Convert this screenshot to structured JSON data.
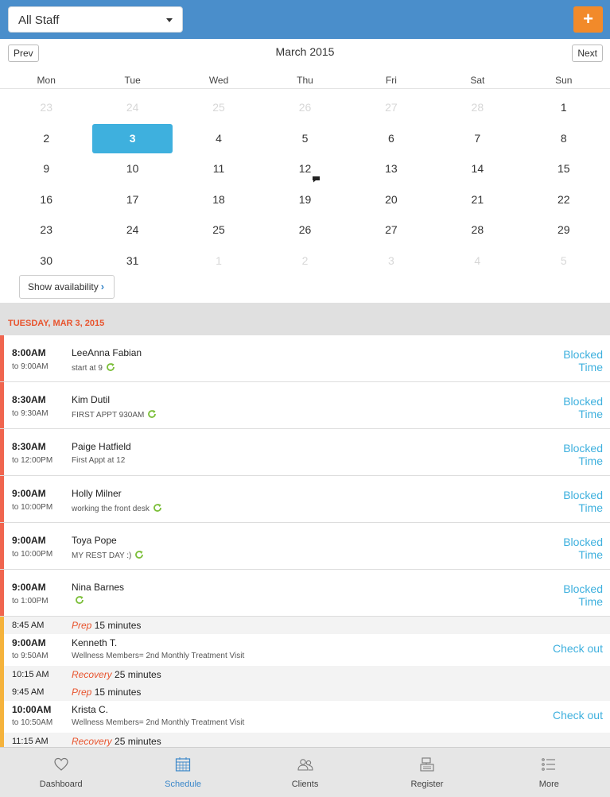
{
  "header": {
    "staff_select_value": "All Staff",
    "add_button_label": "+"
  },
  "calendar": {
    "prev_label": "Prev",
    "next_label": "Next",
    "month_title": "March 2015",
    "weekdays": [
      "Mon",
      "Tue",
      "Wed",
      "Thu",
      "Fri",
      "Sat",
      "Sun"
    ],
    "weeks": [
      [
        "23",
        "24",
        "25",
        "26",
        "27",
        "28",
        "1"
      ],
      [
        "2",
        "3",
        "4",
        "5",
        "6",
        "7",
        "8"
      ],
      [
        "9",
        "10",
        "11",
        "12",
        "13",
        "14",
        "15"
      ],
      [
        "16",
        "17",
        "18",
        "19",
        "20",
        "21",
        "22"
      ],
      [
        "23",
        "24",
        "25",
        "26",
        "27",
        "28",
        "29"
      ],
      [
        "30",
        "31",
        "1",
        "2",
        "3",
        "4",
        "5"
      ]
    ],
    "selected_day": "3",
    "show_availability_label": "Show availability"
  },
  "day_header": "TUESDAY, MAR 3, 2015",
  "blocked": [
    {
      "start": "8:00AM",
      "end": "to 9:00AM",
      "name": "LeeAnna Fabian",
      "note": "start at 9",
      "recurring": true,
      "action1": "Blocked",
      "action2": "Time"
    },
    {
      "start": "8:30AM",
      "end": "to 9:30AM",
      "name": "Kim Dutil",
      "note": "FIRST APPT 930AM",
      "recurring": true,
      "action1": "Blocked",
      "action2": "Time"
    },
    {
      "start": "8:30AM",
      "end": "to 12:00PM",
      "name": "Paige Hatfield",
      "note": "First Appt at 12",
      "recurring": false,
      "action1": "Blocked",
      "action2": "Time"
    },
    {
      "start": "9:00AM",
      "end": "to 10:00PM",
      "name": "Holly Milner",
      "note": "working the front desk",
      "recurring": true,
      "action1": "Blocked",
      "action2": "Time"
    },
    {
      "start": "9:00AM",
      "end": "to 10:00PM",
      "name": "Toya Pope",
      "note": "MY REST DAY :)",
      "recurring": true,
      "action1": "Blocked",
      "action2": "Time"
    },
    {
      "start": "9:00AM",
      "end": "to 1:00PM",
      "name": "Nina Barnes",
      "note": "",
      "recurring": true,
      "action1": "Blocked",
      "action2": "Time"
    }
  ],
  "schedule": [
    {
      "type": "gap",
      "time": "8:45 AM",
      "kind": "Prep",
      "duration": "15 minutes"
    },
    {
      "type": "appt",
      "start": "9:00AM",
      "end": "to 9:50AM",
      "name": "Kenneth T.",
      "service": "Wellness Members= 2nd Monthly Treatment Visit",
      "action": "Check out"
    },
    {
      "type": "gap",
      "time": "10:15 AM",
      "kind": "Recovery",
      "duration": "25 minutes"
    },
    {
      "type": "gap",
      "time": "9:45 AM",
      "kind": "Prep",
      "duration": "15 minutes"
    },
    {
      "type": "appt",
      "start": "10:00AM",
      "end": "to 10:50AM",
      "name": "Krista C.",
      "service": "Wellness Members= 2nd Monthly Treatment Visit",
      "action": "Check out"
    },
    {
      "type": "gap",
      "time": "11:15 AM",
      "kind": "Recovery",
      "duration": "25 minutes"
    }
  ],
  "tabs": [
    {
      "label": "Dashboard",
      "icon": "heart-icon"
    },
    {
      "label": "Schedule",
      "icon": "calendar-icon",
      "active": true
    },
    {
      "label": "Clients",
      "icon": "clients-icon"
    },
    {
      "label": "Register",
      "icon": "register-icon"
    },
    {
      "label": "More",
      "icon": "list-icon"
    }
  ],
  "colors": {
    "header_bg": "#4a8ecb",
    "add_button": "#f28a2a",
    "selected_day": "#3eb0de",
    "blocked_bar": "#f0654f",
    "appt_bar": "#f5b33c",
    "date_header_text": "#e8542e",
    "action_text": "#3eb0de"
  }
}
